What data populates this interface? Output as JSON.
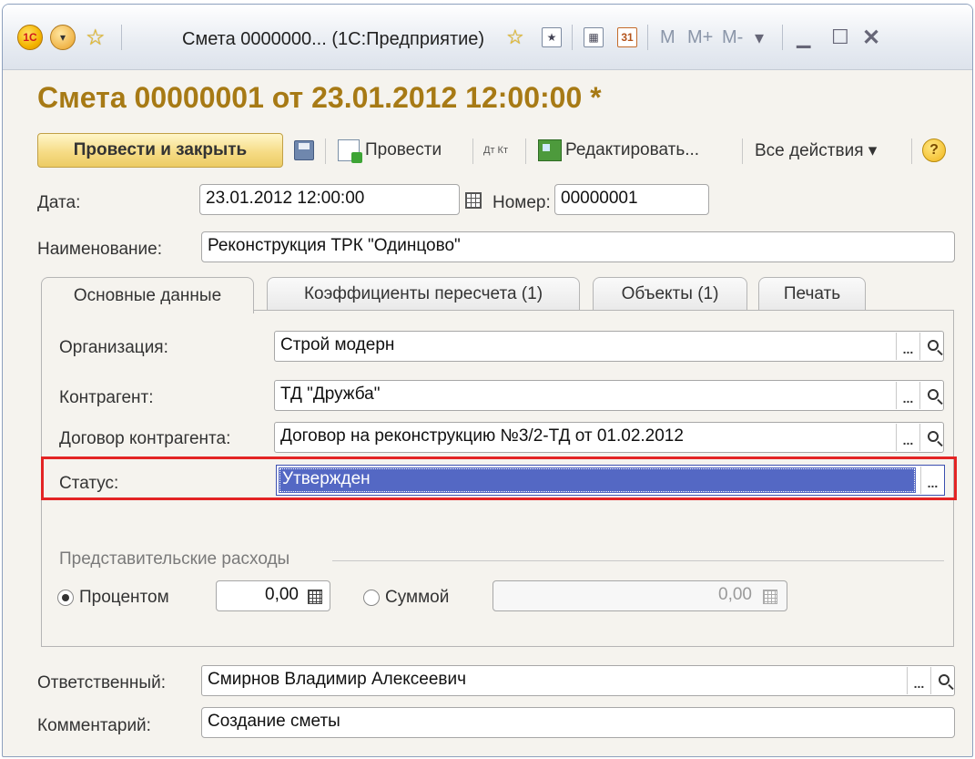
{
  "window": {
    "title": "Смета 0000000... (1С:Предприятие)",
    "logo_text": "1С",
    "m_label": "M",
    "m_plus_label": "M+",
    "m_minus_label": "M-",
    "calendar_day": "31"
  },
  "document": {
    "title": "Смета 00000001 от 23.01.2012 12:00:00 *"
  },
  "toolbar": {
    "post_and_close": "Провести и закрыть",
    "post": "Провести",
    "dtkt": "Дт Кт",
    "edit": "Редактировать...",
    "all_actions": "Все действия ▾",
    "help": "?"
  },
  "form": {
    "date_label": "Дата:",
    "date_value": "23.01.2012 12:00:00",
    "number_label": "Номер:",
    "number_value": "00000001",
    "name_label": "Наименование:",
    "name_value": "Реконструкция ТРК \"Одинцово\""
  },
  "tabs": [
    {
      "label": "Основные данные",
      "active": true
    },
    {
      "label": "Коэффициенты пересчета (1)",
      "active": false
    },
    {
      "label": "Объекты (1)",
      "active": false
    },
    {
      "label": "Печать",
      "active": false
    }
  ],
  "main": {
    "org_label": "Организация:",
    "org_value": "Строй модерн",
    "contractor_label": "Контрагент:",
    "contractor_value": "ТД \"Дружба\"",
    "contract_label": "Договор контрагента:",
    "contract_value": "Договор на реконструкцию №3/2-ТД от 01.02.2012",
    "status_label": "Статус:",
    "status_value": "Утвержден",
    "select_button": "...",
    "rep_group_title": "Представительские расходы",
    "percent_label": "Процентом",
    "percent_value": "0,00",
    "sum_label": "Суммой",
    "sum_value": "0,00"
  },
  "footer": {
    "responsible_label": "Ответственный:",
    "responsible_value": "Смирнов Владимир Алексеевич",
    "comment_label": "Комментарий:",
    "comment_value": "Создание сметы"
  },
  "colors": {
    "title_gold": "#a77a15",
    "selection_blue": "#5468c4",
    "highlight_red": "#e32424"
  }
}
